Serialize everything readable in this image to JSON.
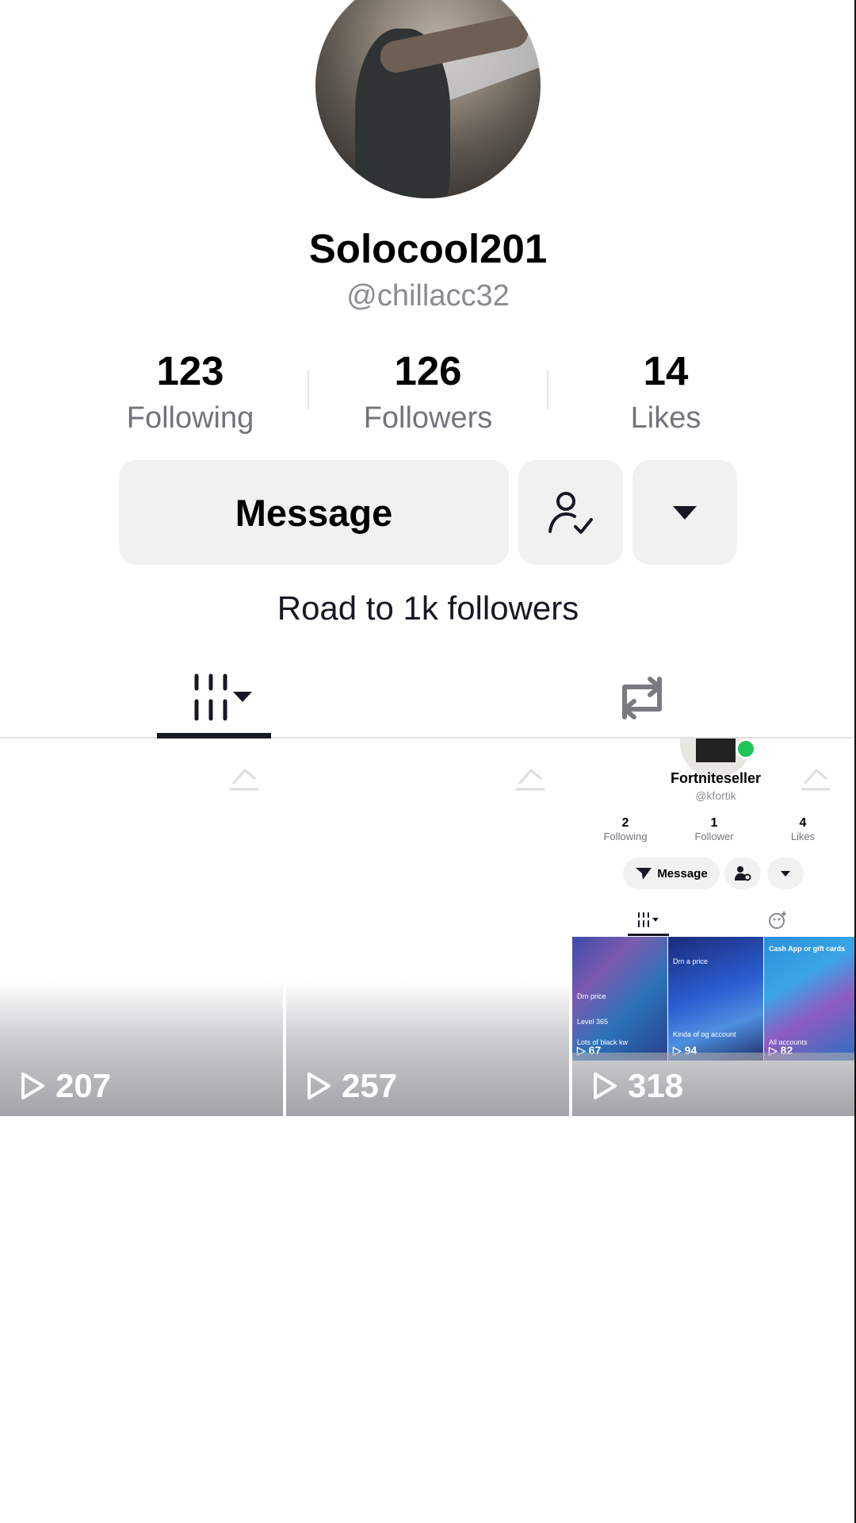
{
  "profile": {
    "display_name": "Solocool201",
    "handle": "@chillacc32",
    "bio": "Road to 1k followers",
    "avatar_icon": "avatar-photo"
  },
  "stats": {
    "following": {
      "value": "123",
      "label": "Following"
    },
    "followers": {
      "value": "126",
      "label": "Followers"
    },
    "likes": {
      "value": "14",
      "label": "Likes"
    }
  },
  "actions": {
    "message_label": "Message",
    "follow_icon": "person-check-icon",
    "more_icon": "caret-down-icon"
  },
  "tabs": [
    {
      "name": "videos",
      "icon": "grid-icon",
      "active": true
    },
    {
      "name": "reposts",
      "icon": "repost-icon",
      "active": false
    }
  ],
  "videos": [
    {
      "views": "207"
    },
    {
      "views": "257"
    },
    {
      "views": "318"
    }
  ],
  "embedded_profile": {
    "display_name": "Fortniteseller",
    "handle": "@kfortik",
    "following": {
      "value": "2",
      "label": "Following"
    },
    "followers": {
      "value": "1",
      "label": "Follower"
    },
    "likes": {
      "value": "4",
      "label": "Likes"
    },
    "message_label": "Message",
    "thumbnails": [
      {
        "caption_top": "Drn price",
        "caption_mid": "Level 365",
        "caption_bottom": "Lots of black kw",
        "views": "67"
      },
      {
        "caption_top": "Drn a price",
        "caption_bottom": "Kinda of og account",
        "views": "94"
      },
      {
        "caption_top": "Cash App or gift cards",
        "caption_bottom": "All accounts",
        "views": "82"
      }
    ]
  },
  "colors": {
    "background": "#ffffff",
    "text_primary": "#161823",
    "text_secondary": "#73747b",
    "button_bg": "#f1f1f2",
    "online_dot": "#20c55a"
  }
}
